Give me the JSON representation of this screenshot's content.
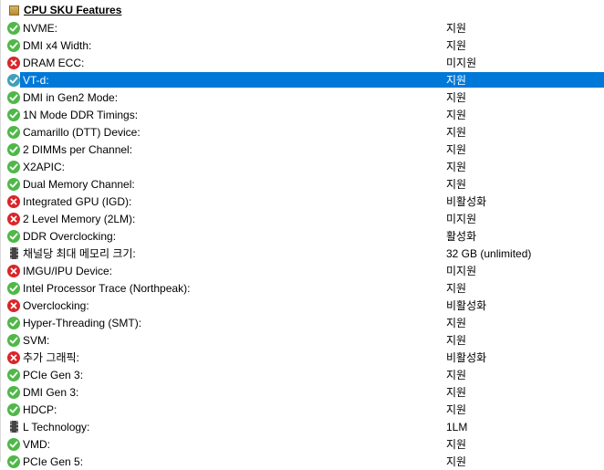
{
  "section": {
    "title": "CPU SKU Features"
  },
  "rows": [
    {
      "name": "NVME:",
      "value": "지원",
      "icon": "check"
    },
    {
      "name": "DMI x4 Width:",
      "value": "지원",
      "icon": "check"
    },
    {
      "name": "DRAM ECC:",
      "value": "미지원",
      "icon": "cross"
    },
    {
      "name": "VT-d:",
      "value": "지원",
      "icon": "check",
      "selected": true
    },
    {
      "name": "DMI in Gen2 Mode:",
      "value": "지원",
      "icon": "check"
    },
    {
      "name": "1N Mode DDR Timings:",
      "value": "지원",
      "icon": "check"
    },
    {
      "name": "Camarillo (DTT) Device:",
      "value": "지원",
      "icon": "check"
    },
    {
      "name": "2 DIMMs per Channel:",
      "value": "지원",
      "icon": "check"
    },
    {
      "name": "X2APIC:",
      "value": "지원",
      "icon": "check"
    },
    {
      "name": "Dual Memory Channel:",
      "value": "지원",
      "icon": "check"
    },
    {
      "name": "Integrated GPU (IGD):",
      "value": "비활성화",
      "icon": "cross"
    },
    {
      "name": "2 Level Memory (2LM):",
      "value": "미지원",
      "icon": "cross"
    },
    {
      "name": "DDR Overclocking:",
      "value": "활성화",
      "icon": "check"
    },
    {
      "name": "채널당 최대 메모리 크기:",
      "value": "32 GB (unlimited)",
      "icon": "chip"
    },
    {
      "name": "IMGU/IPU Device:",
      "value": "미지원",
      "icon": "cross"
    },
    {
      "name": "Intel Processor Trace (Northpeak):",
      "value": "지원",
      "icon": "check"
    },
    {
      "name": "Overclocking:",
      "value": "비활성화",
      "icon": "cross"
    },
    {
      "name": "Hyper-Threading (SMT):",
      "value": "지원",
      "icon": "check"
    },
    {
      "name": "SVM:",
      "value": "지원",
      "icon": "check"
    },
    {
      "name": "추가 그래픽:",
      "value": "비활성화",
      "icon": "cross"
    },
    {
      "name": "PCIe Gen 3:",
      "value": "지원",
      "icon": "check"
    },
    {
      "name": "DMI Gen 3:",
      "value": "지원",
      "icon": "check"
    },
    {
      "name": "HDCP:",
      "value": "지원",
      "icon": "check"
    },
    {
      "name": "L Technology:",
      "value": "1LM",
      "icon": "chip"
    },
    {
      "name": "VMD:",
      "value": "지원",
      "icon": "check"
    },
    {
      "name": "PCIe Gen 5:",
      "value": "지원",
      "icon": "check"
    }
  ],
  "colors": {
    "selection": "#0078d7",
    "ok": "#4fb848",
    "error": "#d9262a"
  }
}
